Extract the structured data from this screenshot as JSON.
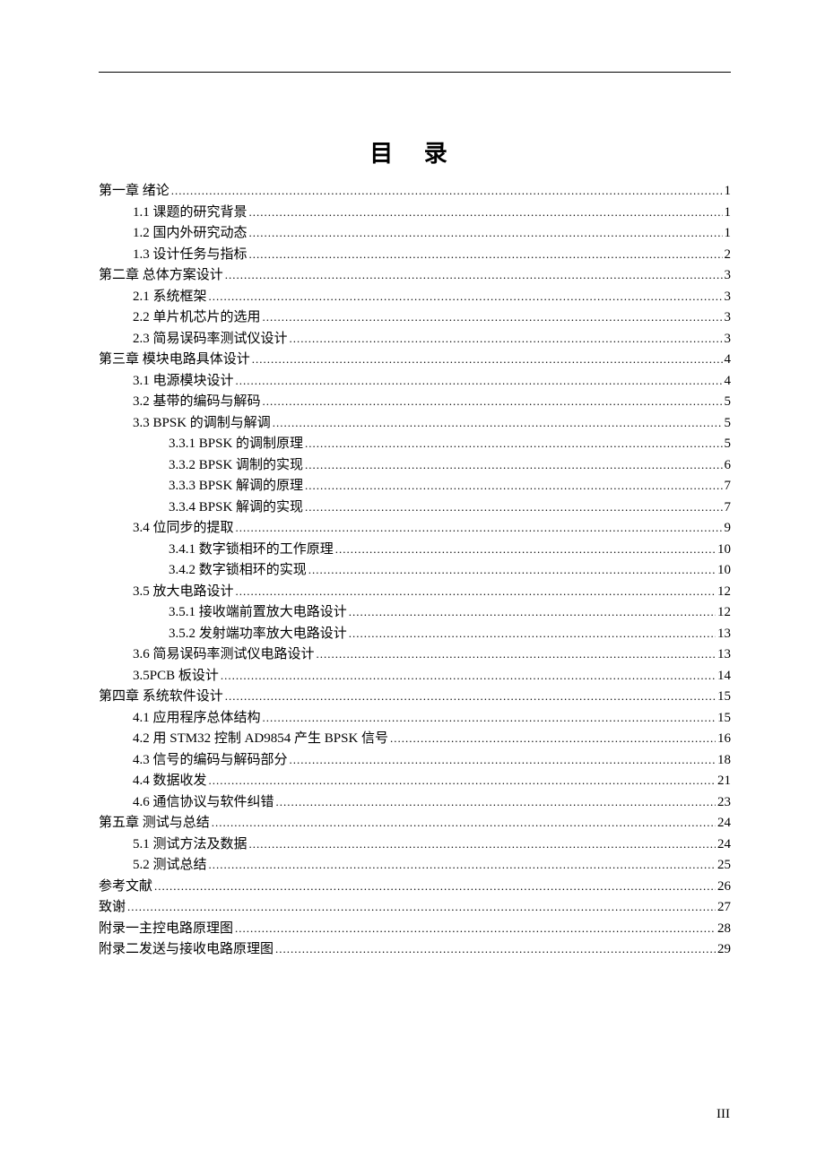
{
  "title": "目 录",
  "page_number": "III",
  "entries": [
    {
      "level": 0,
      "label": "第一章  绪论",
      "page": "1"
    },
    {
      "level": 1,
      "label": "1.1 课题的研究背景",
      "page": "1"
    },
    {
      "level": 1,
      "label": "1.2 国内外研究动态",
      "page": "1"
    },
    {
      "level": 1,
      "label": "1.3 设计任务与指标",
      "page": "2"
    },
    {
      "level": 0,
      "label": "第二章  总体方案设计",
      "page": "3"
    },
    {
      "level": 1,
      "label": "2.1 系统框架",
      "page": "3"
    },
    {
      "level": 1,
      "label": "2.2 单片机芯片的选用",
      "page": "3"
    },
    {
      "level": 1,
      "label": "2.3 简易误码率测试仪设计",
      "page": "3"
    },
    {
      "level": 0,
      "label": "第三章  模块电路具体设计",
      "page": "4"
    },
    {
      "level": 1,
      "label": "3.1 电源模块设计",
      "page": "4"
    },
    {
      "level": 1,
      "label": "3.2 基带的编码与解码",
      "page": "5"
    },
    {
      "level": 1,
      "label": "3.3 BPSK 的调制与解调",
      "page": "5"
    },
    {
      "level": 2,
      "label": "3.3.1 BPSK 的调制原理",
      "page": "5"
    },
    {
      "level": 2,
      "label": "3.3.2 BPSK 调制的实现",
      "page": "6"
    },
    {
      "level": 2,
      "label": "3.3.3 BPSK 解调的原理",
      "page": "7"
    },
    {
      "level": 2,
      "label": "3.3.4 BPSK 解调的实现",
      "page": "7"
    },
    {
      "level": 1,
      "label": "3.4 位同步的提取",
      "page": "9"
    },
    {
      "level": 2,
      "label": "3.4.1 数字锁相环的工作原理",
      "page": "10"
    },
    {
      "level": 2,
      "label": "3.4.2 数字锁相环的实现",
      "page": "10"
    },
    {
      "level": 1,
      "label": "3.5 放大电路设计",
      "page": "12"
    },
    {
      "level": 2,
      "label": "3.5.1 接收端前置放大电路设计",
      "page": "12"
    },
    {
      "level": 2,
      "label": "3.5.2 发射端功率放大电路设计",
      "page": "13"
    },
    {
      "level": 1,
      "label": "3.6 简易误码率测试仪电路设计",
      "page": "13"
    },
    {
      "level": 1,
      "label": "3.5PCB 板设计",
      "page": "14"
    },
    {
      "level": 0,
      "label": "第四章  系统软件设计",
      "page": "15"
    },
    {
      "level": 1,
      "label": "4.1 应用程序总体结构",
      "page": "15"
    },
    {
      "level": 1,
      "label": "4.2 用 STM32 控制 AD9854 产生 BPSK 信号",
      "page": "16"
    },
    {
      "level": 1,
      "label": "4.3 信号的编码与解码部分",
      "page": "18"
    },
    {
      "level": 1,
      "label": "4.4 数据收发",
      "page": "21"
    },
    {
      "level": 1,
      "label": "4.6 通信协议与软件纠错",
      "page": "23"
    },
    {
      "level": 0,
      "label": "第五章  测试与总结",
      "page": "24"
    },
    {
      "level": 1,
      "label": "5.1 测试方法及数据",
      "page": "24"
    },
    {
      "level": 1,
      "label": "5.2 测试总结",
      "page": "25"
    },
    {
      "level": 0,
      "label": "参考文献",
      "page": "26"
    },
    {
      "level": 0,
      "label": "致谢",
      "page": "27"
    },
    {
      "level": 0,
      "label": "附录一主控电路原理图",
      "page": "28"
    },
    {
      "level": 0,
      "label": "附录二发送与接收电路原理图",
      "page": "29"
    }
  ]
}
